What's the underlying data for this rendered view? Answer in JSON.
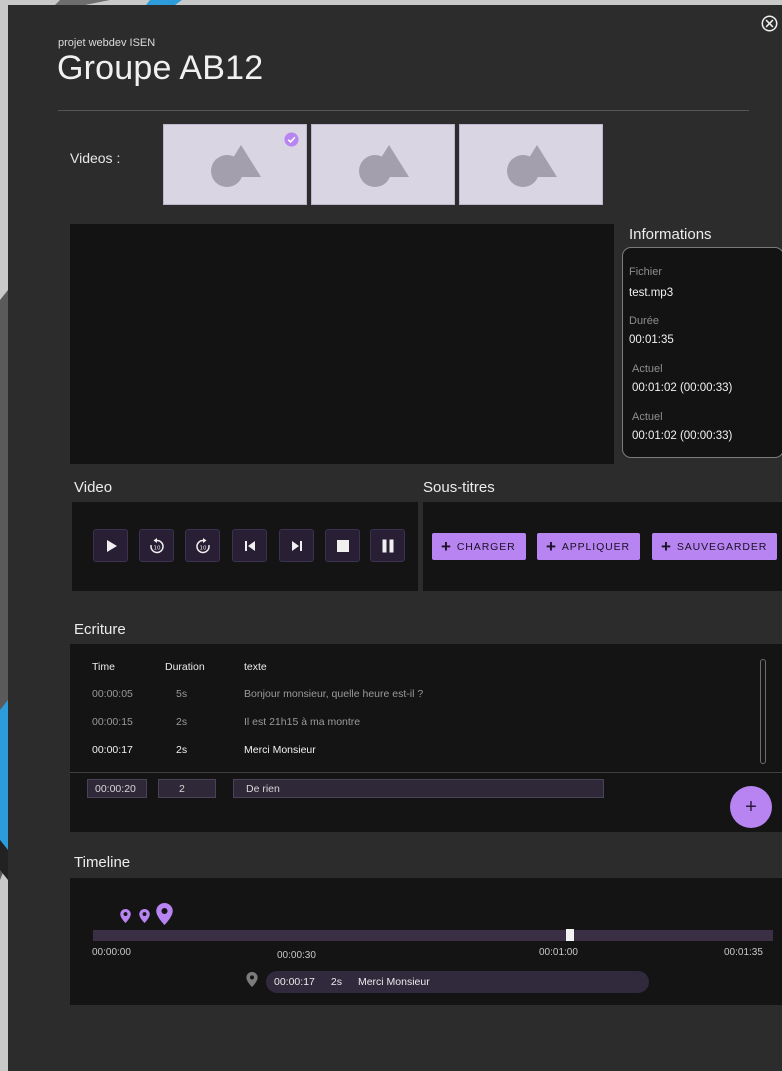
{
  "header": {
    "subtitle": "projet webdev ISEN",
    "title": "Groupe AB12"
  },
  "videos": {
    "label": "Videos :",
    "thumbnails": [
      {
        "selected": true
      },
      {
        "selected": false
      },
      {
        "selected": false
      }
    ]
  },
  "info": {
    "title": "Informations",
    "items": [
      {
        "label": "Fichier",
        "value": "test.mp3"
      },
      {
        "label": "Durée",
        "value": "00:01:35"
      },
      {
        "label": "Actuel",
        "value": "00:01:02 (00:00:33)"
      },
      {
        "label": "Actuel",
        "value": "00:01:02 (00:00:33)"
      }
    ]
  },
  "video_controls": {
    "title": "Video",
    "buttons": [
      "play-icon",
      "replay-10-icon",
      "forward-10-icon",
      "skip-previous-icon",
      "skip-next-icon",
      "stop-icon",
      "pause-icon"
    ]
  },
  "subtitles": {
    "title": "Sous-titres",
    "load_label": "CHARGER",
    "apply_label": "APPLIQUER",
    "save_label": "SAUVEGARDER"
  },
  "ecriture": {
    "title": "Ecriture",
    "columns": {
      "time": "Time",
      "duration": "Duration",
      "text": "texte"
    },
    "rows": [
      {
        "time": "00:00:05",
        "duration": "5s",
        "text": "Bonjour monsieur, quelle heure est-il ?"
      },
      {
        "time": "00:00:15",
        "duration": "2s",
        "text": "Il est 21h15 à ma montre"
      },
      {
        "time": "00:00:17",
        "duration": "2s",
        "text": "Merci Monsieur"
      }
    ],
    "new_entry": {
      "time": "00:00:20",
      "duration": "2",
      "text": "De rien"
    },
    "add_label": "+"
  },
  "timeline": {
    "title": "Timeline",
    "ticks": [
      "00:00:00",
      "00:00:30",
      "00:01:00",
      "00:01:35"
    ],
    "current": {
      "time": "00:00:17",
      "duration": "2s",
      "text": "Merci Monsieur"
    }
  },
  "colors": {
    "accent": "#b784f1",
    "panel": "#141414",
    "background": "#2c2c2c"
  }
}
